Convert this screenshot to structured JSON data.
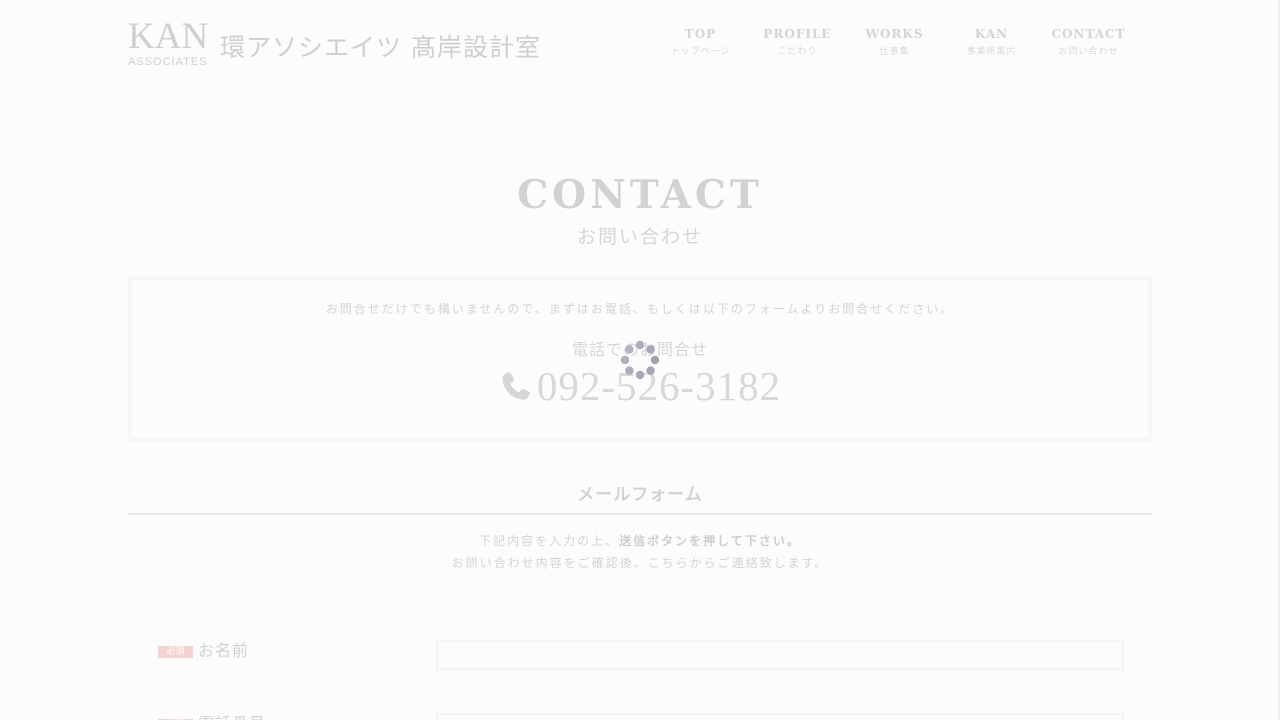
{
  "header": {
    "logo_en": "KAN",
    "logo_en_sub": "ASSOCIATES",
    "logo_jp": "環アソシエイツ 髙岸設計室"
  },
  "nav": [
    {
      "en": "TOP",
      "jp": "トップページ"
    },
    {
      "en": "PROFILE",
      "jp": "こだわり"
    },
    {
      "en": "WORKS",
      "jp": "仕事集"
    },
    {
      "en": "KAN",
      "jp": "事業所案内"
    },
    {
      "en": "CONTACT",
      "jp": "お問い合わせ"
    }
  ],
  "page": {
    "title": "CONTACT",
    "subtitle": "お問い合わせ"
  },
  "intro": {
    "text": "お問合せだけでも構いませんので、まずはお電話、もしくは以下のフォームよりお問合せください。",
    "phone_label": "電話でのお問合せ",
    "phone_number": "092-526-3182",
    "phone_icon": "phone-icon"
  },
  "mail_form": {
    "heading": "メールフォーム",
    "note_line1_pre": "下記内容を入力の上、",
    "note_line1_bold": "送信ボタンを押して下さい。",
    "note_line2": "お問い合わせ内容をご確認後、こちらからご連絡致します。",
    "required_badge": "必須",
    "fields": [
      {
        "label": "お名前",
        "value": ""
      },
      {
        "label": "電話番号",
        "value": ""
      }
    ]
  },
  "loading": {
    "icon": "loading-spinner-icon",
    "color": "#a8a4b8"
  }
}
